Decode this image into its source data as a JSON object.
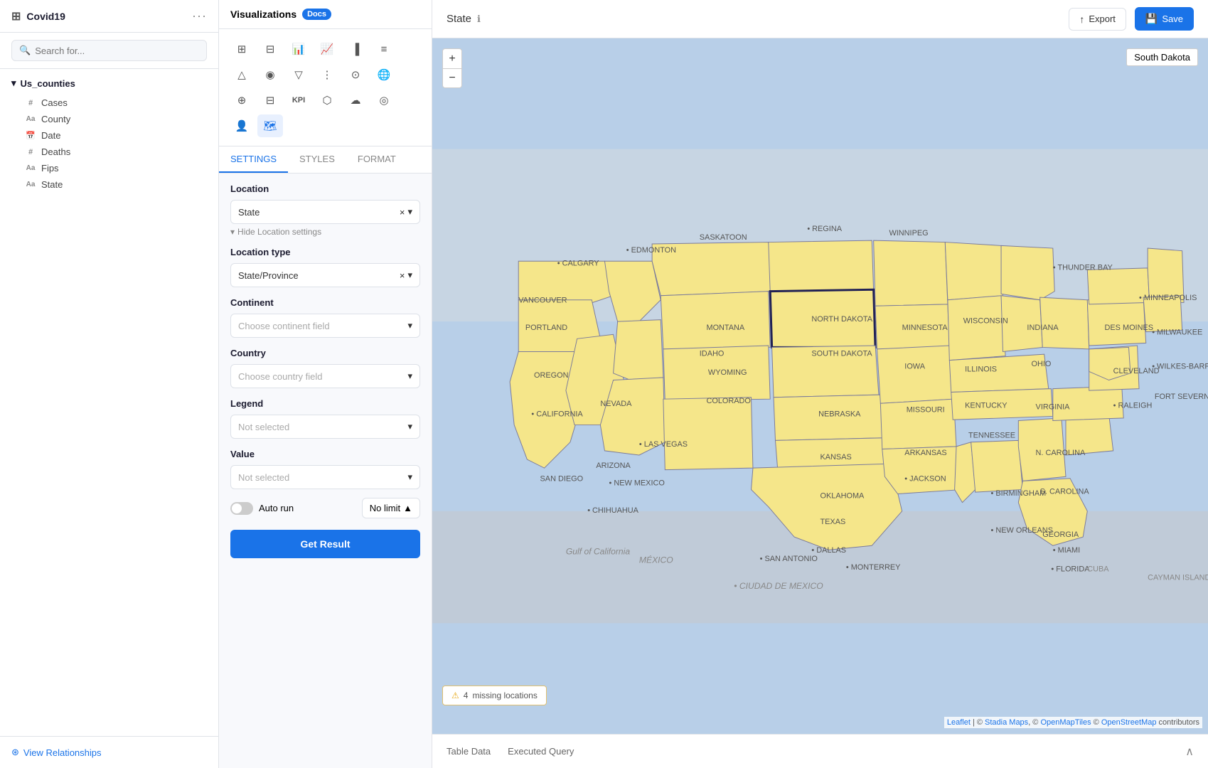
{
  "sidebar": {
    "title": "Covid19",
    "search_placeholder": "Search for...",
    "dataset": {
      "name": "Us_counties",
      "fields": [
        {
          "name": "Cases",
          "type": "#"
        },
        {
          "name": "County",
          "type": "Aa"
        },
        {
          "name": "Date",
          "type": "cal"
        },
        {
          "name": "Deaths",
          "type": "#"
        },
        {
          "name": "Fips",
          "type": "Aa"
        },
        {
          "name": "State",
          "type": "Aa"
        }
      ]
    },
    "view_relationships": "View Relationships"
  },
  "viz_panel": {
    "title": "Visualizations",
    "docs_label": "Docs",
    "tabs": [
      "SETTINGS",
      "STYLES",
      "FORMAT"
    ],
    "active_tab": "SETTINGS",
    "settings": {
      "location_label": "Location",
      "location_value": "State",
      "hide_location_label": "Hide Location settings",
      "location_type_label": "Location type",
      "location_type_value": "State/Province",
      "continent_label": "Continent",
      "continent_placeholder": "Choose continent field",
      "country_label": "Country",
      "country_placeholder": "Choose country field",
      "legend_label": "Legend",
      "legend_placeholder": "Not selected",
      "value_label": "Value",
      "value_placeholder": "Not selected",
      "auto_run_label": "Auto run",
      "no_limit_label": "No limit",
      "get_result_label": "Get Result"
    }
  },
  "main": {
    "title": "State",
    "export_label": "Export",
    "save_label": "Save",
    "tooltip_location": "South Dakota",
    "missing_locations_count": "4",
    "missing_locations_label": "missing locations",
    "zoom_in": "+",
    "zoom_out": "−",
    "bottom_tabs": [
      "Table Data",
      "Executed Query"
    ],
    "attribution": "Leaflet | © Stadia Maps, © OpenMapTiles © OpenStreetMap contributors"
  },
  "icons": {
    "search": "🔍",
    "covid_icon": "⊞",
    "info": "ℹ",
    "export": "↑",
    "save": "💾",
    "warning": "⚠",
    "chevron_down": "▾",
    "close_x": "×",
    "chevron_up": "▴",
    "relationships": "⊛",
    "chevron_right_small": "›",
    "eye_hide": "👁",
    "map_icon": "🗺"
  }
}
